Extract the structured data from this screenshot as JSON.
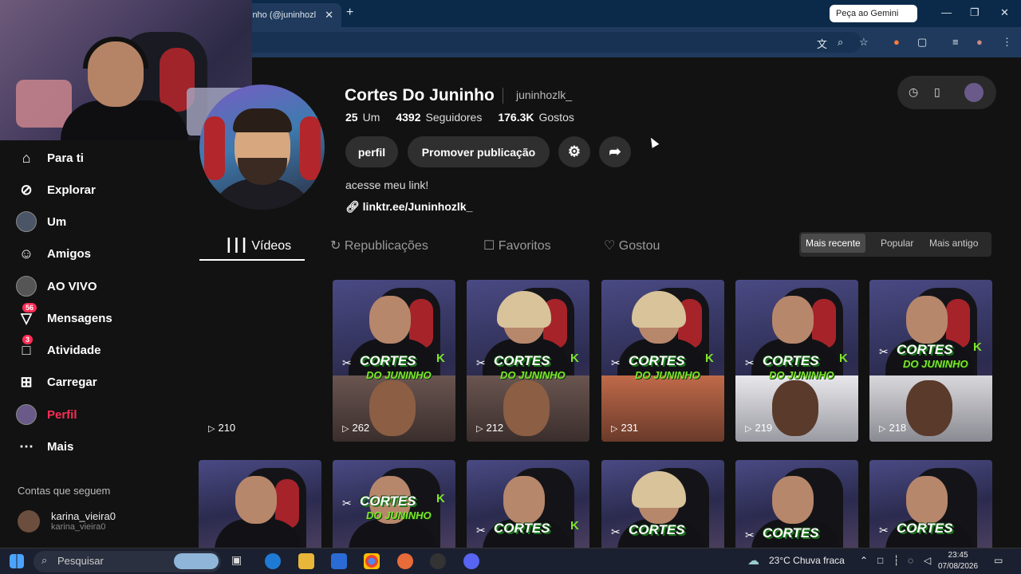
{
  "browser": {
    "tab_title": "inho (@juninhozl",
    "tab_close": "✕",
    "new_tab": "+",
    "gemini_label": "Peça ao Gemini",
    "win_min": "—",
    "win_max": "❐",
    "win_close": "✕"
  },
  "sidebar": {
    "items": [
      {
        "label": "Para ti",
        "icon": "home-icon"
      },
      {
        "label": "Explorar",
        "icon": "compass-icon"
      },
      {
        "label": "Um",
        "icon": "avatar-icon"
      },
      {
        "label": "Amigos",
        "icon": "friends-icon"
      },
      {
        "label": "AO VIVO",
        "icon": "live-icon"
      },
      {
        "label": "Mensagens",
        "icon": "inbox-icon",
        "badge": "56"
      },
      {
        "label": "Atividade",
        "icon": "activity-icon",
        "badge": "3"
      },
      {
        "label": "Carregar",
        "icon": "upload-icon"
      },
      {
        "label": "Perfil",
        "icon": "profile-icon"
      },
      {
        "label": "Mais",
        "icon": "more-icon"
      }
    ],
    "following_title": "Contas que seguem",
    "following": [
      {
        "name": "karina_vieira0",
        "handle": "karina_vieira0"
      }
    ]
  },
  "profile": {
    "name": "Cortes Do Juninho",
    "handle": "juninhozlk_",
    "following_count": "25",
    "following_label": "Um",
    "followers_count": "4392",
    "followers_label": "Seguidores",
    "likes_count": "176.3K",
    "likes_label": "Gostos",
    "edit_button": "perfil",
    "promote_button": "Promover publicação",
    "bio": "acesse meu link!",
    "link": "linktr.ee/Juninhozlk_"
  },
  "tabs": [
    {
      "label": "Vídeos",
      "icon": "grid-icon"
    },
    {
      "label": "Republicações",
      "icon": "repost-icon"
    },
    {
      "label": "Favoritos",
      "icon": "bookmark-icon"
    },
    {
      "label": "Gostou",
      "icon": "heart-icon"
    }
  ],
  "sort": {
    "options": [
      "Mais recente",
      "Popular",
      "Mais antigo"
    ],
    "selected": "Mais recente"
  },
  "videos": {
    "row1_views": [
      "210",
      "262",
      "212",
      "231",
      "219",
      "218"
    ],
    "logo_title": "CORTES",
    "logo_sub": "DO JUNINHO",
    "logo_k": "K"
  },
  "taskbar": {
    "search_placeholder": "Pesquisar",
    "weather": "23°C  Chuva fraca",
    "time": "23:45",
    "date": "07/08/2026"
  }
}
